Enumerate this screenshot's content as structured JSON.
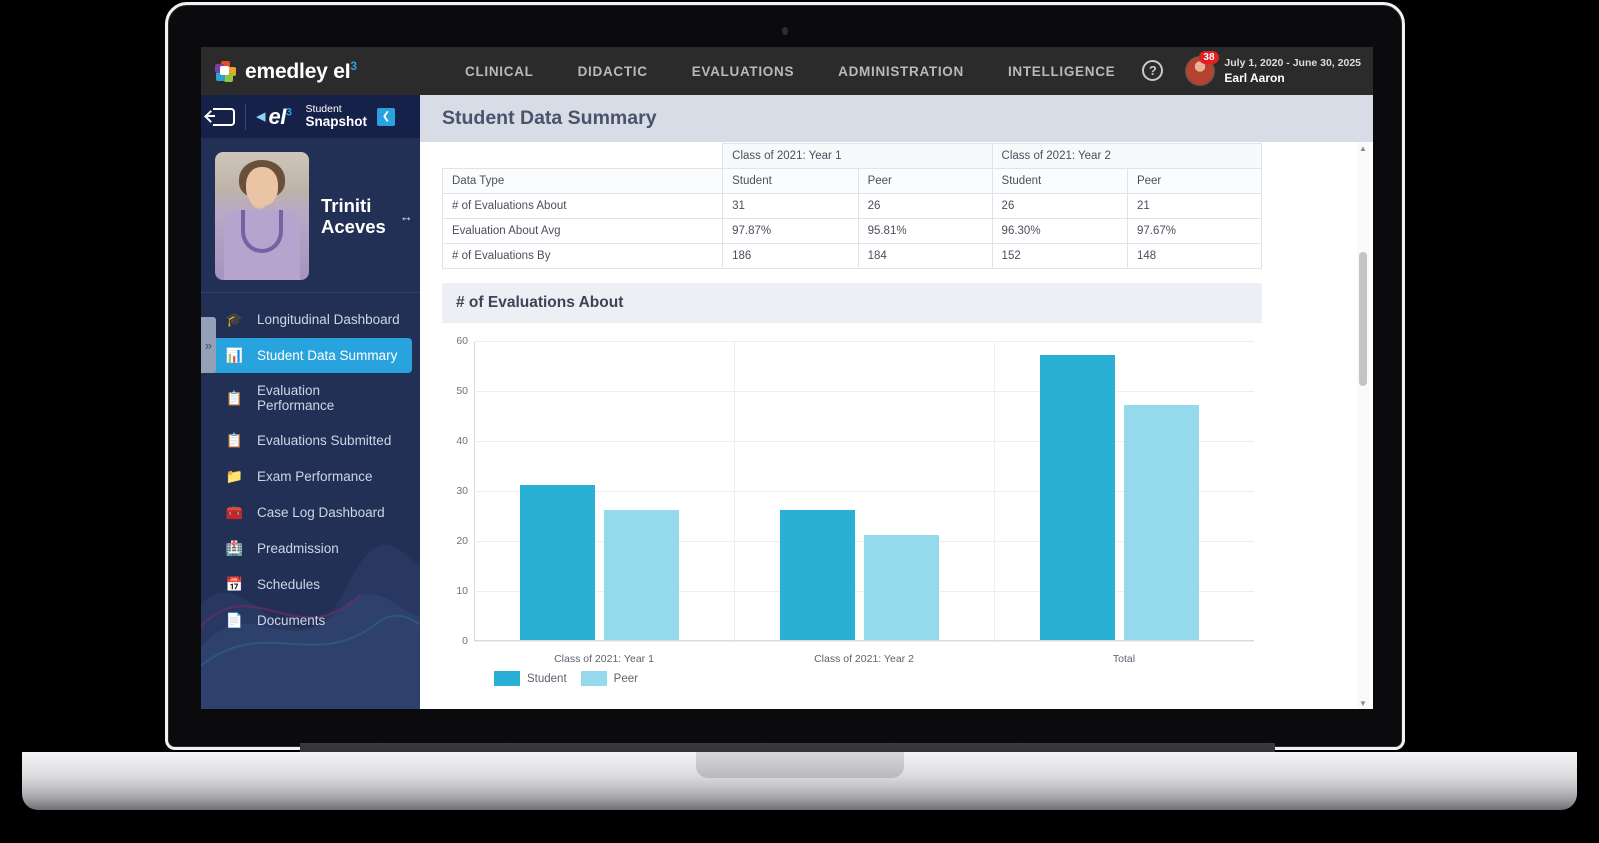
{
  "topbar": {
    "brand": "emedley eI",
    "brand_sup": "3",
    "nav": [
      {
        "label": "CLINICAL"
      },
      {
        "label": "DIDACTIC"
      },
      {
        "label": "EVALUATIONS"
      },
      {
        "label": "ADMINISTRATION"
      },
      {
        "label": "INTELLIGENCE"
      }
    ],
    "help_icon": "?",
    "badge_count": "38",
    "date_range": "July 1, 2020 - June 30, 2025",
    "user_name": "Earl Aaron"
  },
  "sidebar": {
    "logo_text": "eI",
    "logo_sup": "3",
    "app_line1": "Student",
    "app_line2": "Snapshot",
    "collapse_glyph": "❮",
    "handle_glyph": "»",
    "student_name_line1": "Triniti",
    "student_name_line2": "Aceves",
    "compare_glyph": "↔",
    "items": [
      {
        "label": "Longitudinal Dashboard",
        "icon": "graduation-cap-icon",
        "glyph": "🎓",
        "active": false
      },
      {
        "label": "Student Data Summary",
        "icon": "bar-chart-icon",
        "glyph": "📊",
        "active": true
      },
      {
        "label": "Evaluation Performance",
        "icon": "clipboard-icon",
        "glyph": "📋",
        "active": false
      },
      {
        "label": "Evaluations Submitted",
        "icon": "clipboard-list-icon",
        "glyph": "📋",
        "active": false
      },
      {
        "label": "Exam Performance",
        "icon": "folder-icon",
        "glyph": "📁",
        "active": false
      },
      {
        "label": "Case Log Dashboard",
        "icon": "medical-case-icon",
        "glyph": "🧰",
        "active": false
      },
      {
        "label": "Preadmission",
        "icon": "hospital-icon",
        "glyph": "🏥",
        "active": false
      },
      {
        "label": "Schedules",
        "icon": "calendar-icon",
        "glyph": "📅",
        "active": false
      },
      {
        "label": "Documents",
        "icon": "document-icon",
        "glyph": "📄",
        "active": false
      }
    ]
  },
  "page": {
    "title": "Student Data Summary"
  },
  "table": {
    "group_headers": [
      "",
      "Class of 2021: Year 1",
      "Class of 2021: Year 2"
    ],
    "columns": [
      "Data Type",
      "Student",
      "Peer",
      "Student",
      "Peer"
    ],
    "rows": [
      {
        "cells": [
          "# of Evaluations About",
          "31",
          "26",
          "26",
          "21"
        ]
      },
      {
        "cells": [
          "Evaluation About Avg",
          "97.87%",
          "95.81%",
          "96.30%",
          "97.67%"
        ]
      },
      {
        "cells": [
          "# of Evaluations By",
          "186",
          "184",
          "152",
          "148"
        ]
      }
    ]
  },
  "chart_data": {
    "type": "bar",
    "title": "# of Evaluations About",
    "categories": [
      "Class of 2021: Year 1",
      "Class of 2021: Year 2",
      "Total"
    ],
    "series": [
      {
        "name": "Student",
        "values": [
          31,
          26,
          57
        ],
        "color": "#29b0d4"
      },
      {
        "name": "Peer",
        "values": [
          26,
          21,
          47
        ],
        "color": "#95d9ec"
      }
    ],
    "xlabel": "",
    "ylabel": "",
    "ylim": [
      0,
      60
    ],
    "yticks": [
      0,
      10,
      20,
      30,
      40,
      50,
      60
    ],
    "grid": true,
    "legend_position": "bottom-left"
  },
  "scrollbar": {
    "up_glyph": "▲",
    "down_glyph": "▼"
  }
}
